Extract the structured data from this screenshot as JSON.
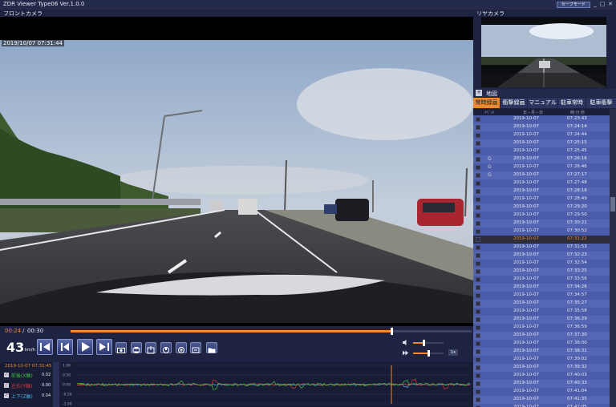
{
  "window": {
    "title": "ZDR Viewer Type06 Ver.1.0.0",
    "safe_mode_label": "セーフモード",
    "minimize": "_",
    "maximize": "□",
    "close": "✕"
  },
  "front_camera": {
    "label": "フロントカメラ",
    "timestamp": "2019/10/07 07:31:44"
  },
  "rear_camera": {
    "label": "リヤカメラ"
  },
  "map": {
    "label": "地図",
    "toggle": "+"
  },
  "tabs": [
    {
      "label": "常時録画",
      "active": true
    },
    {
      "label": "衝撃録画",
      "active": false
    },
    {
      "label": "マニュアル",
      "active": false
    },
    {
      "label": "駐車常時",
      "active": false
    },
    {
      "label": "駐車衝撃",
      "active": false
    }
  ],
  "file_list": {
    "headers": {
      "event": "ｲﾍﾞﾝﾄ",
      "date": "年－月－日",
      "time": "時:分:秒"
    },
    "selected_index": 15,
    "rows": [
      {
        "event": "",
        "date": "2019-10-07",
        "time": "07:23:43"
      },
      {
        "event": "",
        "date": "2019-10-07",
        "time": "07:24:14"
      },
      {
        "event": "",
        "date": "2019-10-07",
        "time": "07:24:44"
      },
      {
        "event": "",
        "date": "2019-10-07",
        "time": "07:25:15"
      },
      {
        "event": "",
        "date": "2019-10-07",
        "time": "07:25:45"
      },
      {
        "event": "G",
        "date": "2019-10-07",
        "time": "07:26:16"
      },
      {
        "event": "G",
        "date": "2019-10-07",
        "time": "07:26:46"
      },
      {
        "event": "G",
        "date": "2019-10-07",
        "time": "07:27:17"
      },
      {
        "event": "",
        "date": "2019-10-07",
        "time": "07:27:48"
      },
      {
        "event": "",
        "date": "2019-10-07",
        "time": "07:28:18"
      },
      {
        "event": "",
        "date": "2019-10-07",
        "time": "07:28:49"
      },
      {
        "event": "",
        "date": "2019-10-07",
        "time": "07:29:20"
      },
      {
        "event": "",
        "date": "2019-10-07",
        "time": "07:29:50"
      },
      {
        "event": "",
        "date": "2019-10-07",
        "time": "07:30:21"
      },
      {
        "event": "",
        "date": "2019-10-07",
        "time": "07:30:52"
      },
      {
        "event": "",
        "date": "2019-10-07",
        "time": "07:31:22"
      },
      {
        "event": "",
        "date": "2019-10-07",
        "time": "07:31:53"
      },
      {
        "event": "",
        "date": "2019-10-07",
        "time": "07:32:23"
      },
      {
        "event": "",
        "date": "2019-10-07",
        "time": "07:32:54"
      },
      {
        "event": "",
        "date": "2019-10-07",
        "time": "07:33:25"
      },
      {
        "event": "",
        "date": "2019-10-07",
        "time": "07:33:56"
      },
      {
        "event": "",
        "date": "2019-10-07",
        "time": "07:34:26"
      },
      {
        "event": "",
        "date": "2019-10-07",
        "time": "07:34:57"
      },
      {
        "event": "",
        "date": "2019-10-07",
        "time": "07:35:27"
      },
      {
        "event": "",
        "date": "2019-10-07",
        "time": "07:35:58"
      },
      {
        "event": "",
        "date": "2019-10-07",
        "time": "07:36:29"
      },
      {
        "event": "",
        "date": "2019-10-07",
        "time": "07:36:59"
      },
      {
        "event": "",
        "date": "2019-10-07",
        "time": "07:37:30"
      },
      {
        "event": "",
        "date": "2019-10-07",
        "time": "07:38:00"
      },
      {
        "event": "",
        "date": "2019-10-07",
        "time": "07:38:31"
      },
      {
        "event": "",
        "date": "2019-10-07",
        "time": "07:39:02"
      },
      {
        "event": "",
        "date": "2019-10-07",
        "time": "07:39:32"
      },
      {
        "event": "",
        "date": "2019-10-07",
        "time": "07:40:03"
      },
      {
        "event": "",
        "date": "2019-10-07",
        "time": "07:40:33"
      },
      {
        "event": "",
        "date": "2019-10-07",
        "time": "07:41:04"
      },
      {
        "event": "",
        "date": "2019-10-07",
        "time": "07:41:35"
      },
      {
        "event": "",
        "date": "2019-10-07",
        "time": "07:42:05"
      }
    ]
  },
  "playback": {
    "current_time": "00:24",
    "separator": "/",
    "total_time": "00:30",
    "progress_fraction": 0.8,
    "speed_value": "43",
    "speed_unit": "km/h",
    "volume_fraction": 0.35,
    "rate_fraction": 0.5,
    "rate_label": "1x"
  },
  "graph": {
    "timestamp": "2019-10-07 07:31:45",
    "y_ticks": [
      "1.00",
      "0.50",
      "0.00",
      "-0.50",
      "-1.00"
    ],
    "legend": [
      {
        "label": "前後(X軸)",
        "value": "0.02",
        "color": "#3fbf3f"
      },
      {
        "label": "左右(Y軸)",
        "value": "0.00",
        "color": "#e03b3b"
      },
      {
        "label": "上下(Z軸)",
        "value": "0.04",
        "color": "#4aa8e0"
      }
    ],
    "cursor_fraction": 0.8
  },
  "colors": {
    "accent": "#f08a2a",
    "list_row": "#4b5cab",
    "background": "#1d2340"
  }
}
